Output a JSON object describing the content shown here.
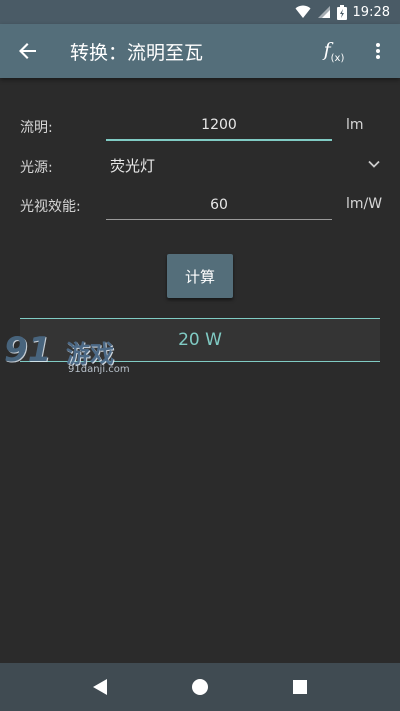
{
  "status_bar": {
    "time": "19:28"
  },
  "toolbar": {
    "title": "转换：流明至瓦",
    "fx_label": "f",
    "fx_sub": "(x)"
  },
  "form": {
    "lumen": {
      "label": "流明:",
      "value": "1200",
      "unit": "lm"
    },
    "light_source": {
      "label": "光源:",
      "value": "荧光灯"
    },
    "efficacy": {
      "label": "光视效能:",
      "value": "60",
      "unit": "lm/W"
    }
  },
  "calculate_label": "计算",
  "result": "20 W",
  "watermark": {
    "number": "91",
    "text": "游戏",
    "site": "91danji.com"
  },
  "colors": {
    "toolbar": "#546e7a",
    "accent": "#80cbc4",
    "background": "#2b2b2b"
  }
}
